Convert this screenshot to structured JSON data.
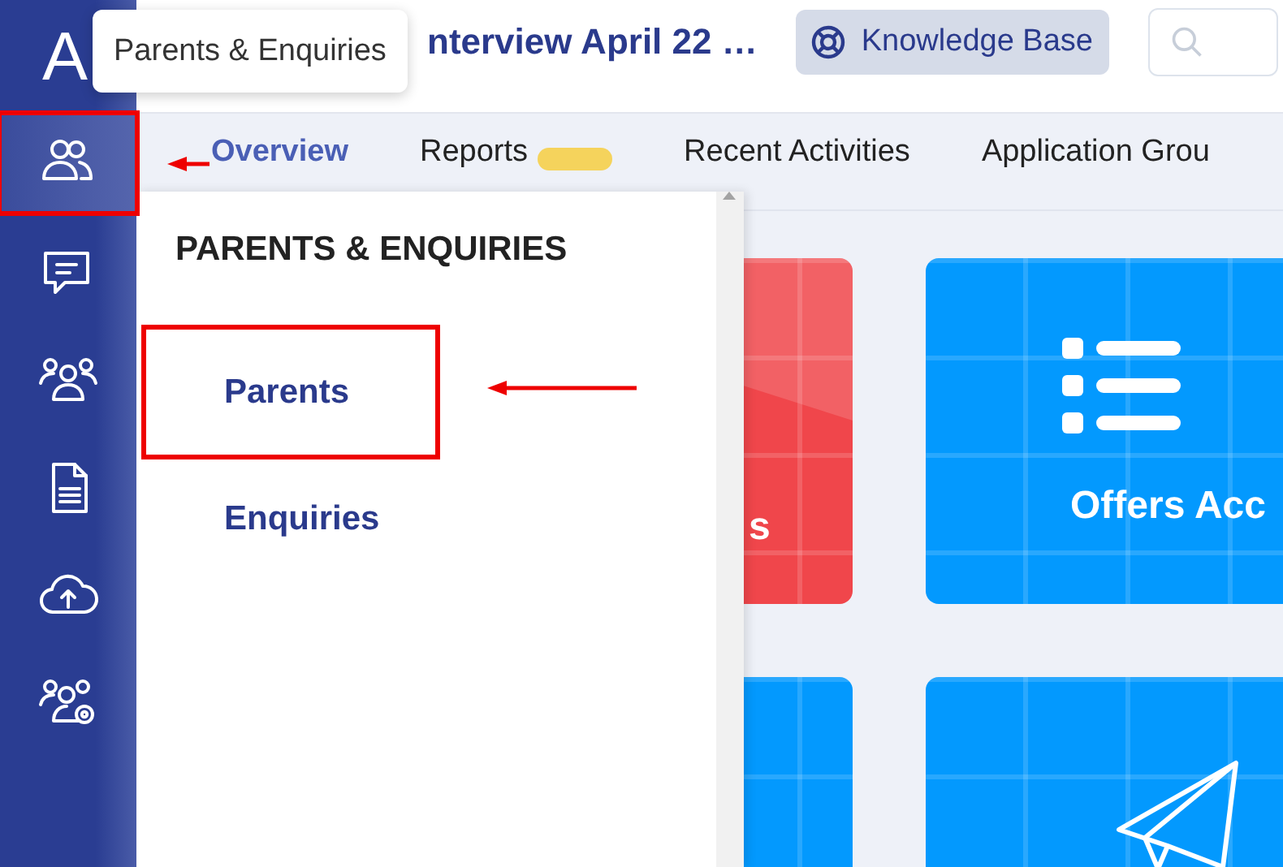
{
  "sidebar": {
    "logo": "A",
    "items": [
      {
        "kind": "users",
        "selected": true,
        "annotated": true
      },
      {
        "kind": "chat",
        "selected": false,
        "annotated": false
      },
      {
        "kind": "group",
        "selected": false,
        "annotated": false
      },
      {
        "kind": "document",
        "selected": false,
        "annotated": false
      },
      {
        "kind": "cloud-upload",
        "selected": false,
        "annotated": false
      },
      {
        "kind": "group-settings",
        "selected": false,
        "annotated": false
      }
    ]
  },
  "tooltip": "Parents & Enquiries",
  "header": {
    "title": "nterview April 22 …",
    "knowledge_base": "Knowledge Base"
  },
  "tabs": [
    {
      "label": "Overview",
      "selected": true,
      "badge": false
    },
    {
      "label": "Reports",
      "selected": false,
      "badge": true
    },
    {
      "label": "Recent Activities",
      "selected": false,
      "badge": false
    },
    {
      "label": "Application Grou",
      "selected": false,
      "badge": false
    }
  ],
  "flyout": {
    "title": "PARENTS & ENQUIRIES",
    "items": [
      {
        "label": "Parents",
        "annotated": true
      },
      {
        "label": "Enquiries",
        "annotated": false
      }
    ]
  },
  "tiles": [
    {
      "label": "s",
      "color": "#f0464b",
      "kind": "plain"
    },
    {
      "label": "Offers Acc",
      "color": "#0399fe",
      "kind": "list"
    },
    {
      "color": "#0399fe",
      "kind": "plain"
    },
    {
      "color": "#0399fe",
      "kind": "plane"
    }
  ]
}
